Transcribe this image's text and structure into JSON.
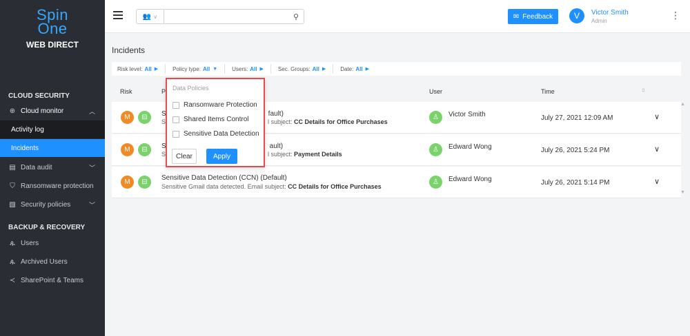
{
  "sidebar": {
    "logo_line1": "Spin",
    "logo_line2": "One",
    "logo_subtitle": "WEB DIRECT",
    "section_cloud": "CLOUD SECURITY",
    "cloud_monitor": "Cloud monitor",
    "activity_log": "Activity log",
    "incidents": "Incidents",
    "data_audit": "Data audit",
    "ransomware": "Ransomware protection",
    "security_policies": "Security policies",
    "section_backup": "BACKUP & RECOVERY",
    "users": "Users",
    "archived_users": "Archived Users",
    "sharepoint": "SharePoint & Teams"
  },
  "topbar": {
    "search_placeholder": "",
    "feedback_label": "Feedback",
    "user_initial": "V",
    "user_name": "Victor Smith",
    "user_role": "Admin"
  },
  "page": {
    "title": "Incidents"
  },
  "filters": {
    "risk_label": "Risk level:",
    "risk_value": "All",
    "policy_label": "Policy type:",
    "policy_value": "All",
    "users_label": "Users:",
    "users_value": "All",
    "groups_label": "Sec. Groups:",
    "groups_value": "All",
    "date_label": "Date:",
    "date_value": "All"
  },
  "table": {
    "col_risk": "Risk",
    "col_policy": "P",
    "col_user": "User",
    "col_time": "Time",
    "rows": [
      {
        "risk": "M",
        "policy_name": "S                                   fault)",
        "policy_prefix": "S",
        "policy_suffix": "fault)",
        "desc_prefix": "S",
        "desc_text": "l subject: ",
        "desc_bold": "CC Details for Office Purchases",
        "user": "Victor Smith",
        "time": "July 27, 2021 12:09 AM"
      },
      {
        "risk": "M",
        "policy_prefix": "S",
        "policy_suffix": "ault)",
        "desc_prefix": "S",
        "desc_text": "l subject: ",
        "desc_bold": "Payment Details",
        "user": "Edward Wong",
        "time": "July 26, 2021 5:24 PM"
      },
      {
        "risk": "M",
        "policy_name": "Sensitive Data Detection (CCN) (Default)",
        "desc_text": "Sensitive Gmail data detected. Email subject: ",
        "desc_bold": "CC Details for Office Purchases",
        "user": "Edward Wong",
        "time": "July 26, 2021 5:14 PM"
      }
    ]
  },
  "popup": {
    "title": "Data Policies",
    "options": [
      "Ransomware Protection",
      "Shared Items Control",
      "Sensitive Data Detection"
    ],
    "clear_label": "Clear",
    "apply_label": "Apply"
  },
  "colors": {
    "accent": "#1e90ff",
    "sidebar_bg": "#2a2d33",
    "risk_medium": "#f08a24",
    "highlight_border": "#e84a4a"
  }
}
